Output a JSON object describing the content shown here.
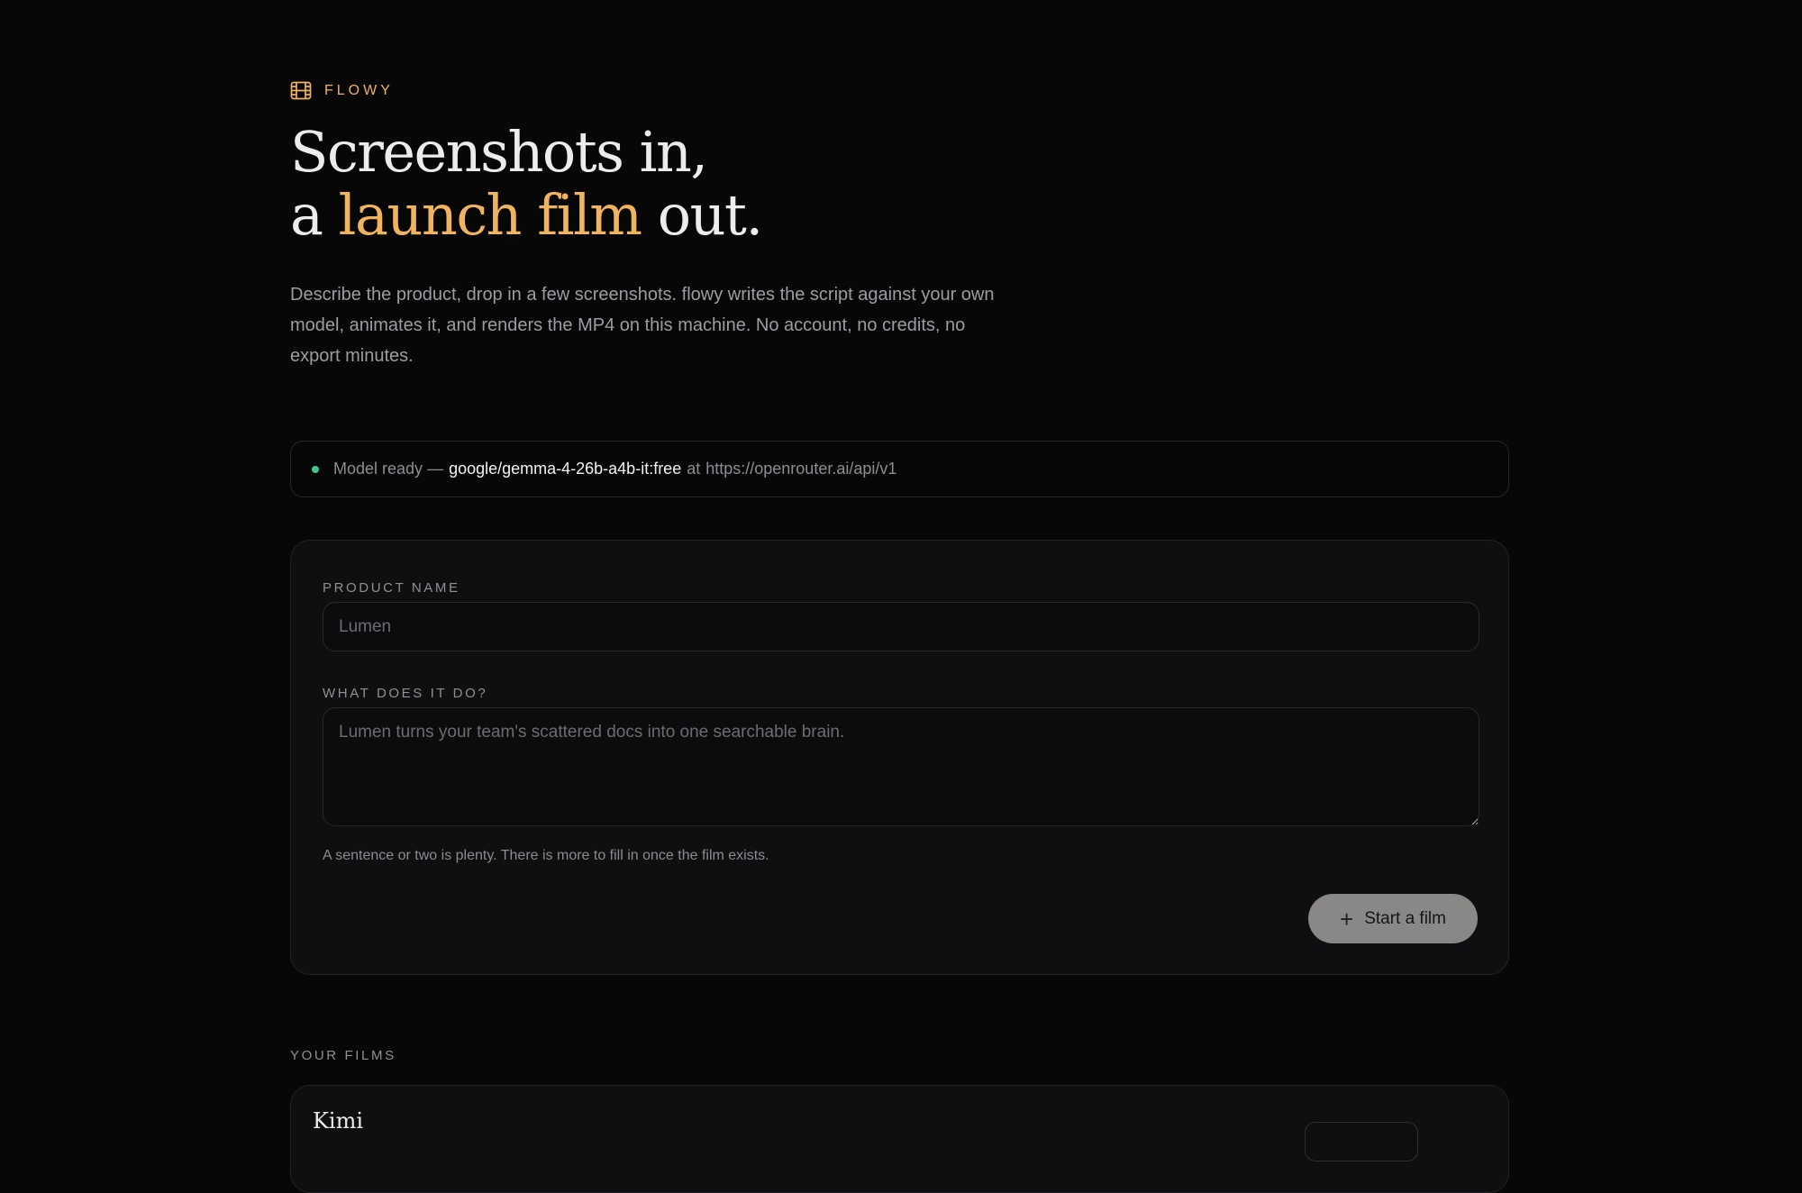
{
  "brand": {
    "name": "FLOWY",
    "accent_color": "#f0b35e",
    "icon": "film-icon"
  },
  "hero": {
    "line1": "Screenshots in,",
    "line2_before": "a ",
    "line2_accent": "launch film",
    "line2_after": " out.",
    "description": "Describe the product, drop in a few screenshots. flowy writes the script against your own model, animates it, and renders the MP4 on this machine. No account, no credits, no export minutes."
  },
  "status": {
    "prefix": "Model ready —",
    "model": "google/gemma-4-26b-a4b-it:free",
    "separator": "at",
    "url": "https://openrouter.ai/api/v1",
    "dot_color": "#44c487"
  },
  "form": {
    "product_name_label": "PRODUCT NAME",
    "product_name_value": "",
    "product_name_placeholder": "Lumen",
    "description_label": "WHAT DOES IT DO?",
    "description_value": "",
    "description_placeholder": "Lumen turns your team's scattered docs into one searchable brain.",
    "helper_text": "A sentence or two is plenty. There is more to fill in once the film exists.",
    "start_label": "Start a film"
  },
  "films": {
    "section_label": "YOUR FILMS",
    "items": [
      {
        "title": "Kimi"
      }
    ]
  }
}
